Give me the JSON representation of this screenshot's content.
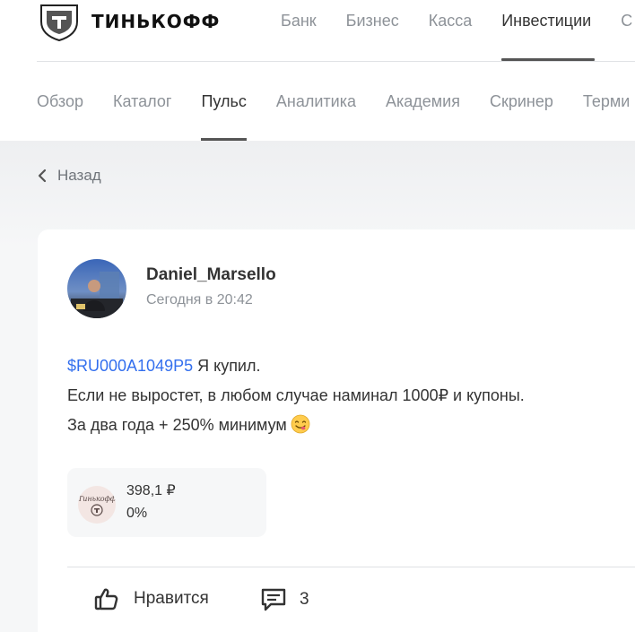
{
  "brand": {
    "name": "ТИНЬКОФФ"
  },
  "topnav": {
    "items": [
      {
        "label": "Банк"
      },
      {
        "label": "Бизнес"
      },
      {
        "label": "Касса"
      },
      {
        "label": "Инвестиции",
        "active": true
      },
      {
        "label": "С"
      }
    ]
  },
  "subnav": {
    "items": [
      {
        "label": "Обзор"
      },
      {
        "label": "Каталог"
      },
      {
        "label": "Пульс",
        "active": true
      },
      {
        "label": "Аналитика"
      },
      {
        "label": "Академия"
      },
      {
        "label": "Скринер"
      },
      {
        "label": "Терми"
      }
    ]
  },
  "back": {
    "label": "Назад",
    "icon": "chevron-left-icon"
  },
  "post": {
    "author": "Daniel_Marsello",
    "time": "Сегодня в 20:42",
    "ticker": "$RU000A1049P5",
    "line1_rest": " Я купил.",
    "line2": "Если не выростет, в любом случае наминал 1000₽ и купоны.",
    "line3": "За два года + 250% минимум",
    "emoji": "face-savoring-food-icon"
  },
  "instrument": {
    "price": "398,1 ₽",
    "change": "0%",
    "logo_text": "Тинькофф"
  },
  "actions": {
    "like_label": "Нравится",
    "like_icon": "thumbs-up-icon",
    "comments_count": "3",
    "comment_icon": "comment-icon"
  },
  "colors": {
    "accent_link": "#336fee",
    "brand_yellow": "#ffdd2d"
  }
}
